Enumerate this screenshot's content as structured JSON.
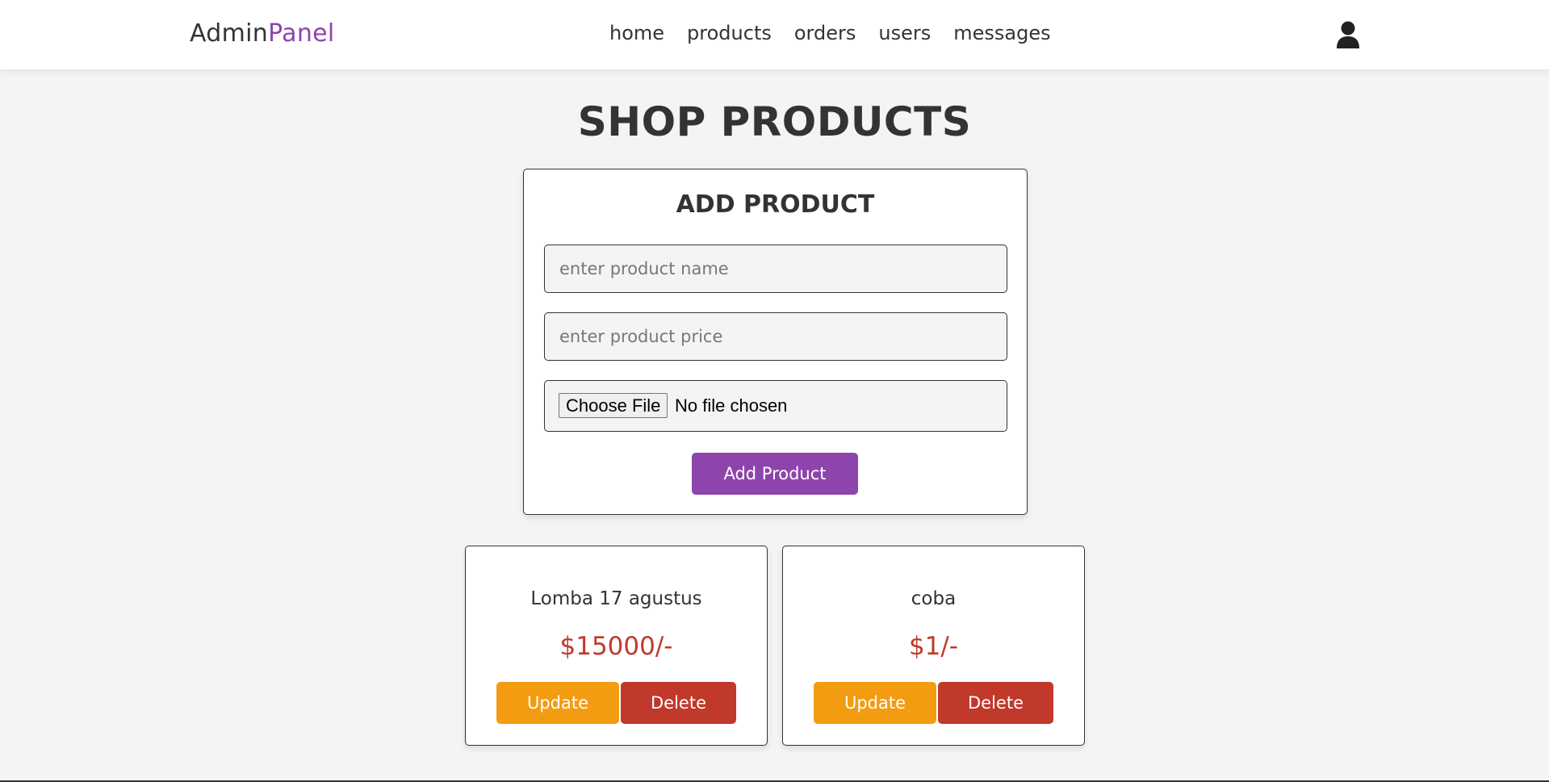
{
  "header": {
    "logo_part1": "Admin",
    "logo_part2": "Panel",
    "nav": [
      "home",
      "products",
      "orders",
      "users",
      "messages"
    ],
    "user_icon": "user-icon"
  },
  "page": {
    "title": "SHOP PRODUCTS"
  },
  "add_product": {
    "title": "ADD PRODUCT",
    "name_placeholder": "enter product name",
    "name_value": "",
    "price_placeholder": "enter product price",
    "price_value": "",
    "file_button": "Choose File",
    "file_status": "No file chosen",
    "submit_label": "Add Product"
  },
  "products": [
    {
      "name": "Lomba 17 agustus",
      "price": "$15000/-",
      "update_label": "Update",
      "delete_label": "Delete"
    },
    {
      "name": "coba",
      "price": "$1/-",
      "update_label": "Update",
      "delete_label": "Delete"
    }
  ],
  "colors": {
    "accent": "#8e44ad",
    "update": "#f39c12",
    "delete": "#c0392b",
    "price": "#c0392b"
  }
}
